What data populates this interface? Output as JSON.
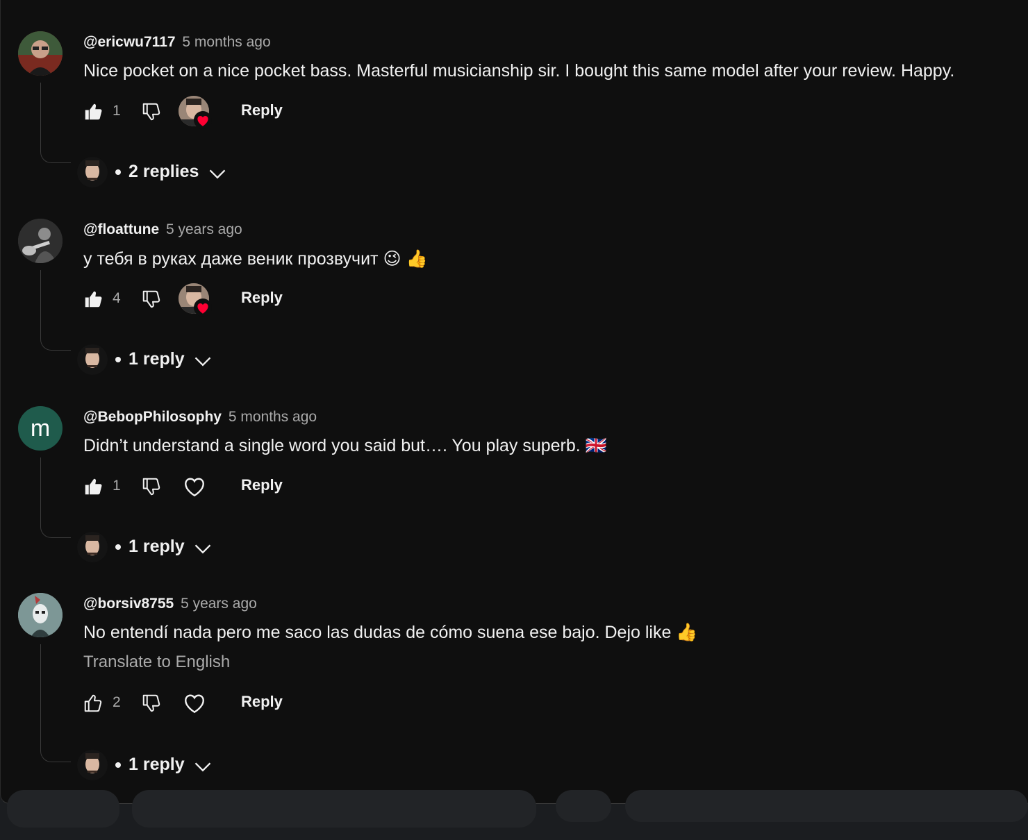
{
  "comments": [
    {
      "author": "@ericwu7117",
      "time": "5 months ago",
      "text": "Nice pocket on a nice pocket bass. Masterful musicianship sir. I bought this same model after your review. Happy.",
      "like_count": "1",
      "reply_label": "Reply",
      "hearted": true,
      "liked": true,
      "replies_label": "2 replies",
      "avatar_icon": "man-with-glasses-avatar"
    },
    {
      "author": "@floattune",
      "time": "5 years ago",
      "text": "у тебя в руках даже веник прозвучит 😉 👍",
      "like_count": "4",
      "reply_label": "Reply",
      "hearted": true,
      "liked": true,
      "replies_label": "1 reply",
      "avatar_icon": "bass-player-avatar"
    },
    {
      "author": "@BebopPhilosophy",
      "time": "5 months ago",
      "text": "Didn’t understand a single word you said but…. You play superb. 🇬🇧",
      "like_count": "1",
      "reply_label": "Reply",
      "hearted": false,
      "liked": true,
      "replies_label": "1 reply",
      "avatar_letter": "m"
    },
    {
      "author": "@borsiv8755",
      "time": "5 years ago",
      "text": "No entendí nada pero me saco las dudas de cómo suena ese bajo. Dejo like 👍",
      "translate_label": "Translate to English",
      "like_count": "2",
      "reply_label": "Reply",
      "hearted": false,
      "liked": false,
      "replies_label": "1 reply",
      "avatar_icon": "warrior-art-avatar"
    }
  ],
  "colors": {
    "background": "#0f0f0f",
    "text_primary": "#f1f1f1",
    "text_secondary": "#aaaaaa",
    "heart": "#ff0033",
    "letter_avatar": "#1f5b4c"
  }
}
